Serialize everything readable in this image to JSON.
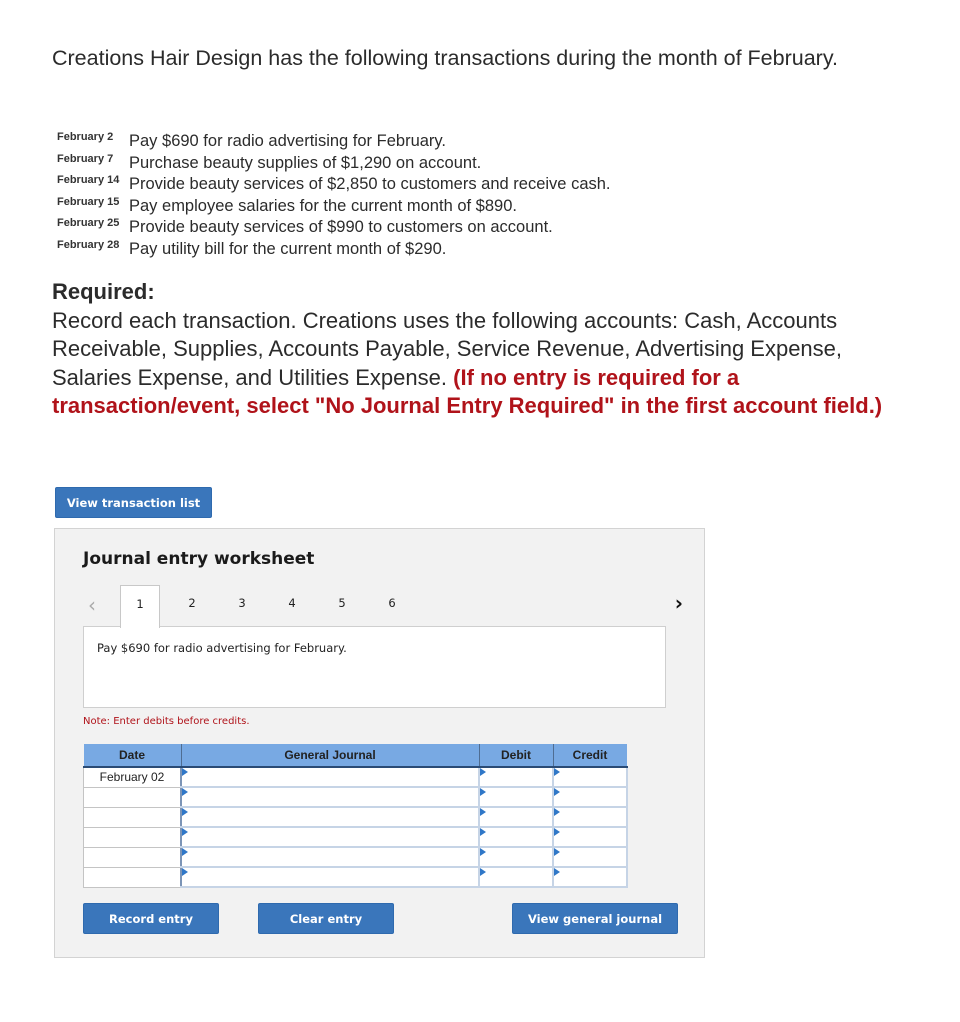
{
  "intro": "Creations Hair Design has the following transactions during the month of February.",
  "transactions": [
    {
      "date": "February 2",
      "description": "Pay $690 for radio advertising for February."
    },
    {
      "date": "February 7",
      "description": "Purchase beauty supplies of $1,290 on account."
    },
    {
      "date": "February 14",
      "description": "Provide beauty services of $2,850 to customers and receive cash."
    },
    {
      "date": "February 15",
      "description": "Pay employee salaries for the current month of $890."
    },
    {
      "date": "February 25",
      "description": "Provide beauty services of $990 to customers on account."
    },
    {
      "date": "February 28",
      "description": "Pay utility bill for the current month of $290."
    }
  ],
  "required": {
    "heading": "Required:",
    "text": "Record each transaction. Creations uses the following accounts: Cash, Accounts Receivable, Supplies, Accounts Payable, Service Revenue, Advertising Expense, Salaries Expense, and Utilities Expense.",
    "instruction": "(If no entry is required for a transaction/event, select \"No Journal Entry Required\" in the first account field.)"
  },
  "buttons": {
    "view_transaction_list": "View transaction list",
    "record_entry": "Record entry",
    "clear_entry": "Clear entry",
    "view_general_journal": "View general journal"
  },
  "worksheet": {
    "title": "Journal entry worksheet",
    "nav_prev": "‹",
    "nav_next": "›",
    "tabs": [
      "1",
      "2",
      "3",
      "4",
      "5",
      "6"
    ],
    "active_tab": "1",
    "description": "Pay $690 for radio advertising for February.",
    "note": "Note: Enter debits before credits.",
    "table": {
      "headers": [
        "Date",
        "General Journal",
        "Debit",
        "Credit"
      ],
      "rows": [
        {
          "date": "February 02",
          "account": "",
          "debit": "",
          "credit": ""
        },
        {
          "date": "",
          "account": "",
          "debit": "",
          "credit": ""
        },
        {
          "date": "",
          "account": "",
          "debit": "",
          "credit": ""
        },
        {
          "date": "",
          "account": "",
          "debit": "",
          "credit": ""
        },
        {
          "date": "",
          "account": "",
          "debit": "",
          "credit": ""
        },
        {
          "date": "",
          "account": "",
          "debit": "",
          "credit": ""
        }
      ]
    }
  },
  "colors": {
    "button_blue": "#3a76bb",
    "header_blue": "#78a9e3",
    "alert_red": "#b0131a",
    "panel_bg": "#f2f2f2"
  }
}
